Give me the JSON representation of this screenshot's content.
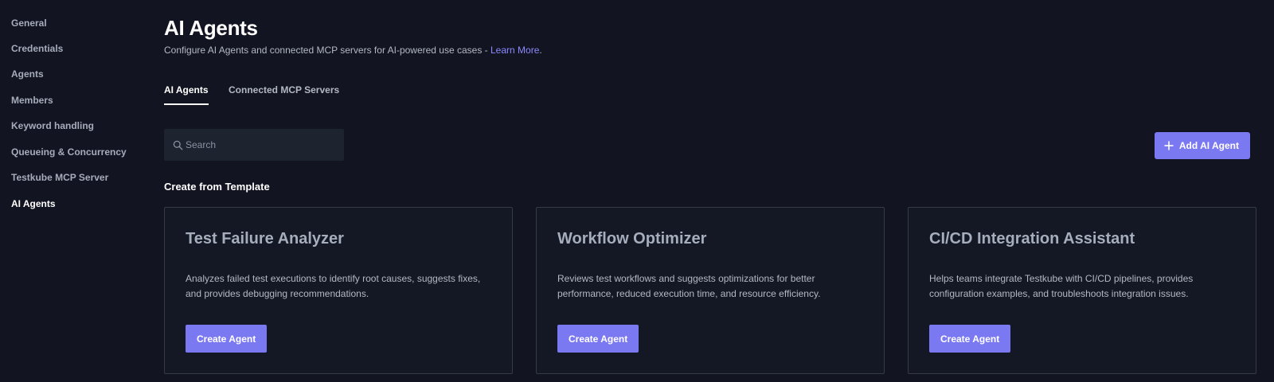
{
  "sidebar": {
    "items": [
      {
        "label": "General",
        "active": false
      },
      {
        "label": "Credentials",
        "active": false
      },
      {
        "label": "Agents",
        "active": false
      },
      {
        "label": "Members",
        "active": false
      },
      {
        "label": "Keyword handling",
        "active": false
      },
      {
        "label": "Queueing & Concurrency",
        "active": false
      },
      {
        "label": "Testkube MCP Server",
        "active": false
      },
      {
        "label": "AI Agents",
        "active": true
      }
    ]
  },
  "header": {
    "title": "AI Agents",
    "subtitle": "Configure AI Agents and connected MCP servers for AI-powered use cases - ",
    "learn_more": "Learn More",
    "subtitle_end": "."
  },
  "tabs": [
    {
      "label": "AI Agents",
      "active": true
    },
    {
      "label": "Connected MCP Servers",
      "active": false
    }
  ],
  "search": {
    "placeholder": "Search",
    "value": "",
    "icon": "search-icon"
  },
  "toolbar": {
    "add_label": "Add AI Agent",
    "add_icon": "plus-icon"
  },
  "templates": {
    "section_title": "Create from Template",
    "cards": [
      {
        "title": "Test Failure Analyzer",
        "description": "Analyzes failed test executions to identify root causes, suggests fixes, and provides debugging recommendations.",
        "button": "Create Agent"
      },
      {
        "title": "Workflow Optimizer",
        "description": "Reviews test workflows and suggests optimizations for better performance, reduced execution time, and resource efficiency.",
        "button": "Create Agent"
      },
      {
        "title": "CI/CD Integration Assistant",
        "description": "Helps teams integrate Testkube with CI/CD pipelines, provides configuration examples, and troubleshoots integration issues.",
        "button": "Create Agent"
      }
    ]
  },
  "colors": {
    "background": "#121521",
    "accent": "#7b79f2",
    "link": "#8c88ff",
    "card_border": "#343a48"
  }
}
